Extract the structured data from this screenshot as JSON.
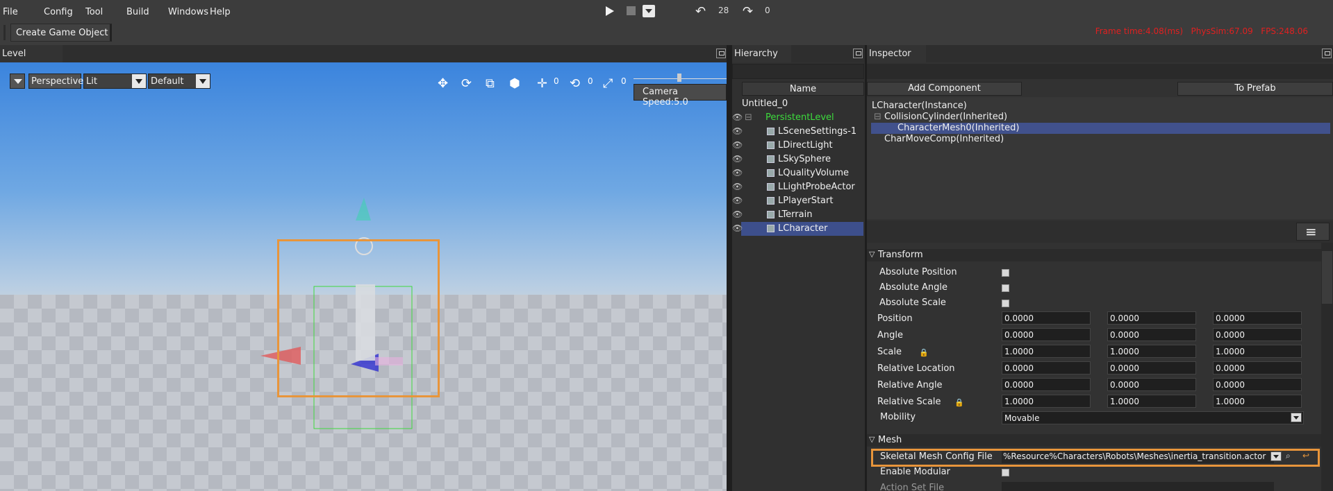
{
  "menu": [
    "File",
    "Config",
    "Tool",
    "Build",
    "Windows",
    "Help"
  ],
  "toolbar": {
    "undo_count": "28",
    "redo_count": "0",
    "create_label": "Create Game Object",
    "stats": "Frame time:4.08(ms)   PhysSim:67.09   FPS:248.06"
  },
  "tabs": {
    "level": "Level",
    "hierarchy": "Hierarchy",
    "inspector": "Inspector"
  },
  "viewport": {
    "perspective": "Perspective",
    "lit": "Lit",
    "default": "Default",
    "move_count": "0",
    "rotate_count": "0",
    "scale_count": "0",
    "camera_speed": "Camera Speed:5.0"
  },
  "hierarchy": {
    "header": "Name",
    "root": "Untitled_0",
    "level": "PersistentLevel",
    "items": [
      "LSceneSettings-1",
      "LDirectLight",
      "LSkySphere",
      "LQualityVolume",
      "LLightProbeActor",
      "LPlayerStart",
      "LTerrain",
      "LCharacter"
    ]
  },
  "inspector": {
    "add_component": "Add Component",
    "to_prefab": "To Prefab",
    "tree": [
      "LCharacter(Instance)",
      "CollisionCylinder(Inherited)",
      "CharacterMesh0(Inherited)",
      "CharMoveComp(Inherited)"
    ],
    "transform_title": "Transform",
    "abs": [
      "Absolute Position",
      "Absolute Angle",
      "Absolute Scale"
    ],
    "rows": [
      {
        "label": "Position",
        "v": [
          "0.0000",
          "0.0000",
          "0.0000"
        ]
      },
      {
        "label": "Angle",
        "v": [
          "0.0000",
          "0.0000",
          "0.0000"
        ]
      },
      {
        "label": "Scale",
        "v": [
          "1.0000",
          "1.0000",
          "1.0000"
        ]
      },
      {
        "label": "Relative Location",
        "v": [
          "0.0000",
          "0.0000",
          "0.0000"
        ]
      },
      {
        "label": "Relative Angle",
        "v": [
          "0.0000",
          "0.0000",
          "0.0000"
        ]
      },
      {
        "label": "Relative Scale",
        "v": [
          "1.0000",
          "1.0000",
          "1.0000"
        ]
      }
    ],
    "mobility_label": "Mobility",
    "mobility_value": "Movable",
    "mesh_title": "Mesh",
    "sk_label": "Skeletal Mesh Config File",
    "sk_value": "%Resource%Characters\\Robots\\Meshes\\inertia_transition.actor",
    "modular_label": "Enable Modular",
    "actionset_label": "Action Set File"
  },
  "colors": {
    "accent": "#e8953b",
    "selection": "#3d4f8c",
    "stats": "#e02020",
    "level_green": "#3ddc3d"
  }
}
